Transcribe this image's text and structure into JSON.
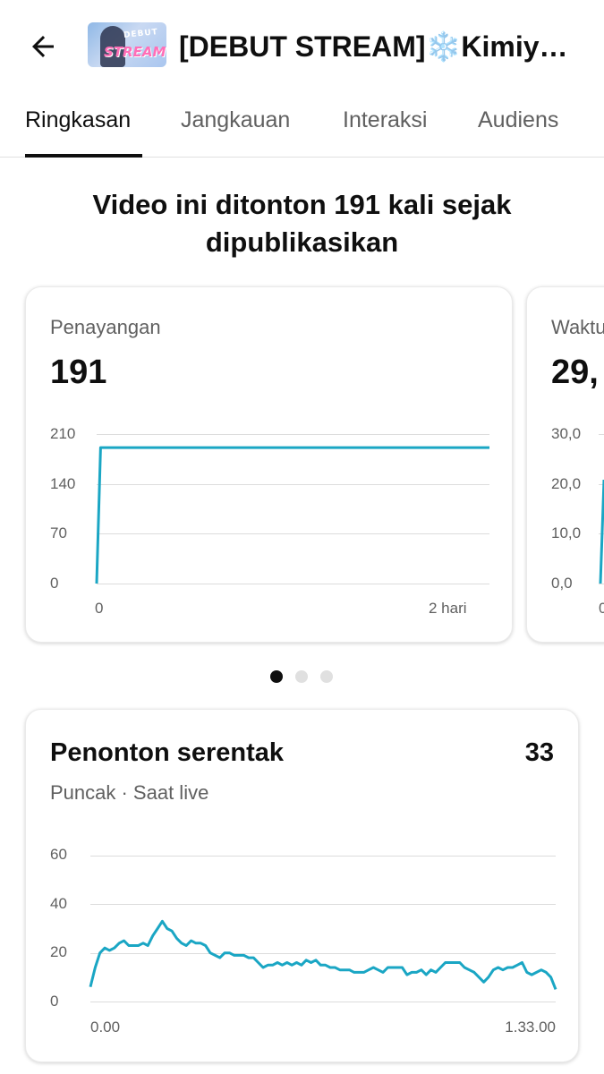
{
  "header": {
    "back_icon": "arrow-back-icon",
    "thumbnail_text_top": "DEBUT",
    "thumbnail_text_main": "STREAM",
    "title": "[DEBUT STREAM]❄️Kimiy…"
  },
  "tabs": [
    {
      "label": "Ringkasan",
      "active": true
    },
    {
      "label": "Jangkauan",
      "active": false
    },
    {
      "label": "Interaksi",
      "active": false
    },
    {
      "label": "Audiens",
      "active": false
    }
  ],
  "headline": "Video ini ditonton 191 kali sejak dipublikasikan",
  "colors": {
    "accent_line": "#1aa6c4",
    "active_dot": "#0f0f0f"
  },
  "cards": [
    {
      "label": "Penayangan",
      "value": "191",
      "chart_data": {
        "type": "line",
        "y_ticks": [
          "210",
          "140",
          "70",
          "0"
        ],
        "ylim": [
          0,
          210
        ],
        "x_ticks": [
          "0",
          "2 hari"
        ],
        "x": [
          0,
          0.02,
          2
        ],
        "y": [
          0,
          191,
          191
        ],
        "grid": true
      }
    },
    {
      "label": "Waktu",
      "value": "29,",
      "chart_data": {
        "type": "line",
        "y_ticks": [
          "30,0",
          "20,0",
          "10,0",
          "0,0"
        ],
        "ylim": [
          0,
          30
        ],
        "x_ticks": [
          "0"
        ],
        "grid": true
      }
    }
  ],
  "pager": {
    "count": 3,
    "active_index": 0
  },
  "concurrent": {
    "title": "Penonton serentak",
    "value": "33",
    "subtitle": "Puncak · Saat live",
    "chart_data": {
      "type": "line",
      "y_ticks": [
        "60",
        "40",
        "20",
        "0"
      ],
      "ylim": [
        0,
        60
      ],
      "x_ticks": [
        "0.00",
        "1.33.00"
      ],
      "values": [
        6,
        14,
        20,
        22,
        21,
        22,
        24,
        25,
        23,
        23,
        23,
        24,
        23,
        27,
        30,
        33,
        30,
        29,
        26,
        24,
        23,
        25,
        24,
        24,
        23,
        20,
        19,
        18,
        20,
        20,
        19,
        19,
        19,
        18,
        18,
        16,
        14,
        15,
        15,
        16,
        15,
        16,
        15,
        16,
        15,
        17,
        16,
        17,
        15,
        15,
        14,
        14,
        13,
        13,
        13,
        12,
        12,
        12,
        13,
        14,
        13,
        12,
        14,
        14,
        14,
        14,
        11,
        12,
        12,
        13,
        11,
        13,
        12,
        14,
        16,
        16,
        16,
        16,
        14,
        13,
        12,
        10,
        8,
        10,
        13,
        14,
        13,
        14,
        14,
        15,
        16,
        12,
        11,
        12,
        13,
        12,
        10,
        5
      ],
      "grid": true
    }
  }
}
